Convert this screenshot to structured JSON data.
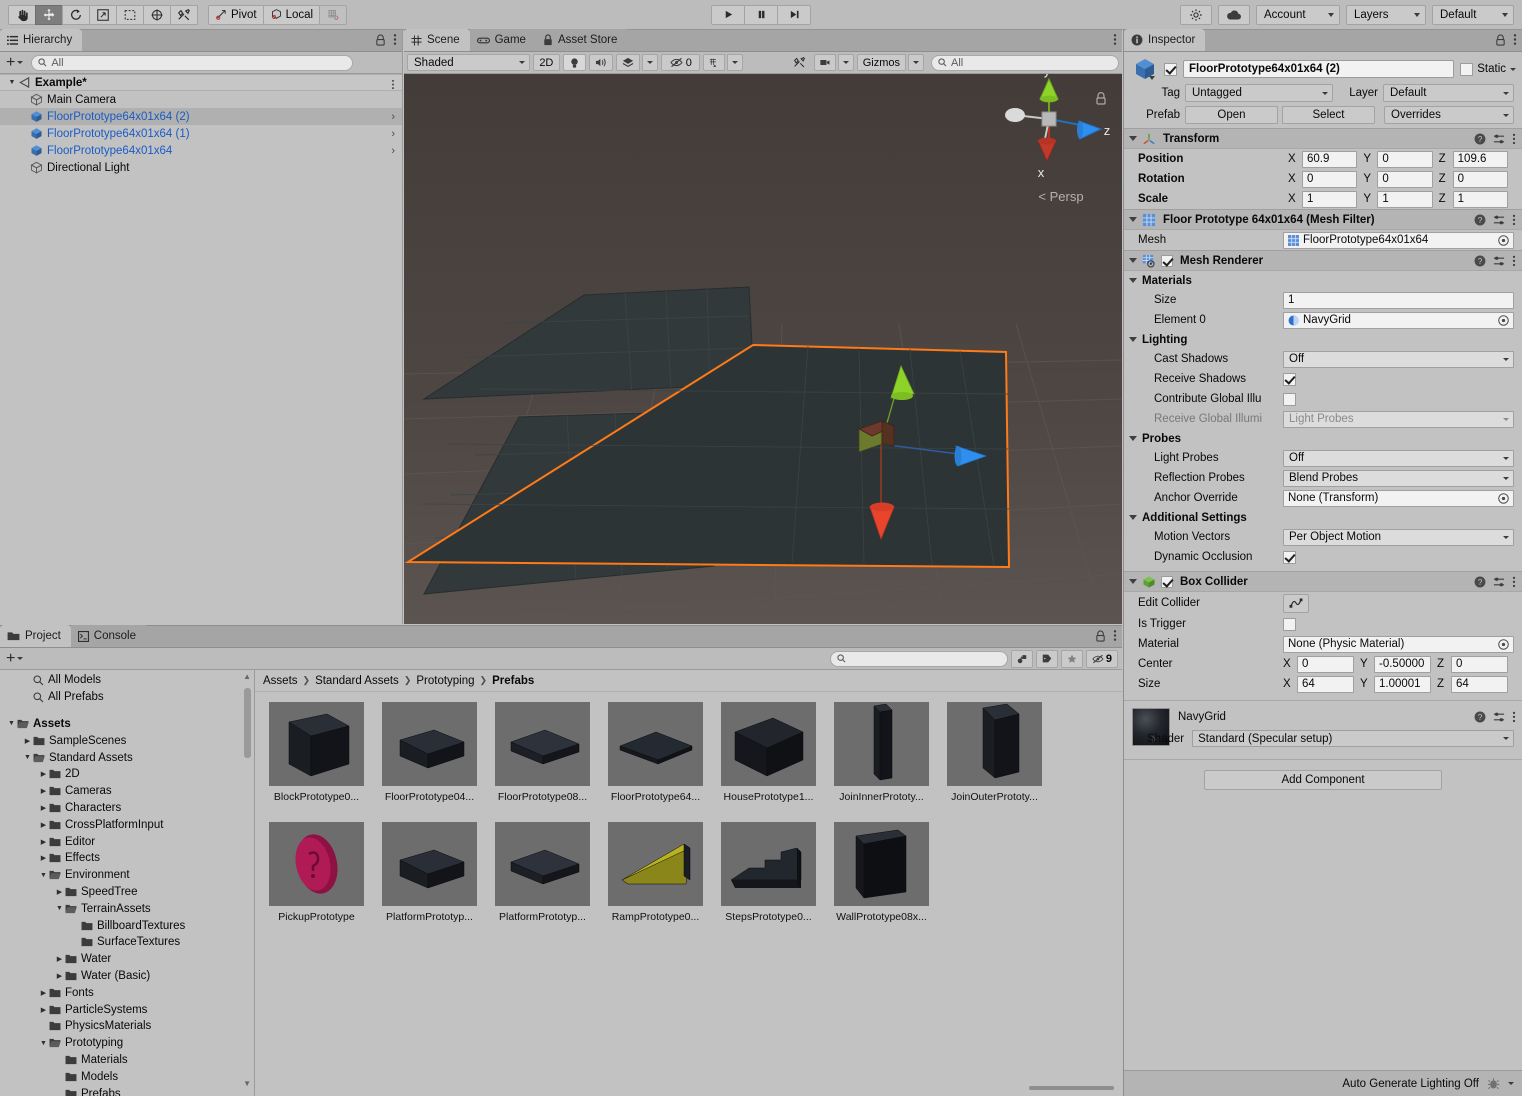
{
  "toolbar": {
    "tools": [
      {
        "name": "hand-tool",
        "icon": "✋",
        "active": false
      },
      {
        "name": "move-tool",
        "icon": "move",
        "active": true
      },
      {
        "name": "rotate-tool",
        "icon": "rotate",
        "active": false
      },
      {
        "name": "scale-tool",
        "icon": "scale",
        "active": false
      },
      {
        "name": "rect-tool",
        "icon": "rect",
        "active": false
      },
      {
        "name": "transform-tool",
        "icon": "transform",
        "active": false
      },
      {
        "name": "custom-tool",
        "icon": "wrench",
        "active": false
      }
    ],
    "pivot_label": "Pivot",
    "local_label": "Local",
    "grid_snap_label": "",
    "play_label": "▶",
    "pause_label": "❚❚",
    "step_label": "▶❚",
    "cloud_label": "",
    "account_label": "Account",
    "layers_label": "Layers",
    "layout_label": "Default"
  },
  "hierarchy": {
    "tab_label": "Hierarchy",
    "search_placeholder": "All",
    "scene_name": "Example*",
    "items": [
      {
        "label": "Main Camera",
        "type": "gameobject",
        "prefab": false,
        "selected": false,
        "chevron": false
      },
      {
        "label": "FloorPrototype64x01x64 (2)",
        "type": "prefab",
        "prefab": true,
        "selected": true,
        "chevron": true
      },
      {
        "label": "FloorPrototype64x01x64 (1)",
        "type": "prefab",
        "prefab": true,
        "selected": false,
        "chevron": true
      },
      {
        "label": "FloorPrototype64x01x64",
        "type": "prefab",
        "prefab": true,
        "selected": false,
        "chevron": true
      },
      {
        "label": "Directional Light",
        "type": "gameobject",
        "prefab": false,
        "selected": false,
        "chevron": false
      }
    ]
  },
  "scene": {
    "tabs": [
      {
        "label": "Scene",
        "icon": "grid-icon",
        "active": true
      },
      {
        "label": "Game",
        "icon": "gamepad-icon",
        "active": false
      },
      {
        "label": "Asset Store",
        "icon": "store-icon",
        "active": false
      }
    ],
    "draw_mode": "Shaded",
    "two_d_label": "2D",
    "hidden_count": "0",
    "gizmos_label": "Gizmos",
    "search_placeholder": "All",
    "axis_labels": {
      "x": "x",
      "y": "y",
      "z": "z"
    },
    "perspective_label": "Persp"
  },
  "project": {
    "tabs": [
      {
        "label": "Project",
        "icon": "folder-icon",
        "active": true
      },
      {
        "label": "Console",
        "icon": "console-icon",
        "active": false
      }
    ],
    "search_placeholder": "",
    "hidden_count": "9",
    "tree": [
      {
        "label": "All Models",
        "depth": 1,
        "arrow": "none",
        "icon": "search",
        "bold": false,
        "open": false
      },
      {
        "label": "All Prefabs",
        "depth": 1,
        "arrow": "none",
        "icon": "search",
        "bold": false,
        "open": false
      },
      {
        "label": "",
        "depth": 0,
        "arrow": "none",
        "icon": "spacer",
        "bold": false,
        "open": false
      },
      {
        "label": "Assets",
        "depth": 0,
        "arrow": "down",
        "icon": "folder-open",
        "bold": true,
        "open": true
      },
      {
        "label": "SampleScenes",
        "depth": 1,
        "arrow": "right",
        "icon": "folder",
        "bold": false,
        "open": false
      },
      {
        "label": "Standard Assets",
        "depth": 1,
        "arrow": "down",
        "icon": "folder-open",
        "bold": false,
        "open": true
      },
      {
        "label": "2D",
        "depth": 2,
        "arrow": "right",
        "icon": "folder",
        "bold": false,
        "open": false
      },
      {
        "label": "Cameras",
        "depth": 2,
        "arrow": "right",
        "icon": "folder",
        "bold": false,
        "open": false
      },
      {
        "label": "Characters",
        "depth": 2,
        "arrow": "right",
        "icon": "folder",
        "bold": false,
        "open": false
      },
      {
        "label": "CrossPlatformInput",
        "depth": 2,
        "arrow": "right",
        "icon": "folder",
        "bold": false,
        "open": false
      },
      {
        "label": "Editor",
        "depth": 2,
        "arrow": "right",
        "icon": "folder",
        "bold": false,
        "open": false
      },
      {
        "label": "Effects",
        "depth": 2,
        "arrow": "right",
        "icon": "folder",
        "bold": false,
        "open": false
      },
      {
        "label": "Environment",
        "depth": 2,
        "arrow": "down",
        "icon": "folder-open",
        "bold": false,
        "open": true
      },
      {
        "label": "SpeedTree",
        "depth": 3,
        "arrow": "right",
        "icon": "folder",
        "bold": false,
        "open": false
      },
      {
        "label": "TerrainAssets",
        "depth": 3,
        "arrow": "down",
        "icon": "folder-open",
        "bold": false,
        "open": true
      },
      {
        "label": "BillboardTextures",
        "depth": 4,
        "arrow": "none",
        "icon": "folder",
        "bold": false,
        "open": false
      },
      {
        "label": "SurfaceTextures",
        "depth": 4,
        "arrow": "none",
        "icon": "folder",
        "bold": false,
        "open": false
      },
      {
        "label": "Water",
        "depth": 3,
        "arrow": "right",
        "icon": "folder",
        "bold": false,
        "open": false
      },
      {
        "label": "Water (Basic)",
        "depth": 3,
        "arrow": "right",
        "icon": "folder",
        "bold": false,
        "open": false
      },
      {
        "label": "Fonts",
        "depth": 2,
        "arrow": "right",
        "icon": "folder",
        "bold": false,
        "open": false
      },
      {
        "label": "ParticleSystems",
        "depth": 2,
        "arrow": "right",
        "icon": "folder",
        "bold": false,
        "open": false
      },
      {
        "label": "PhysicsMaterials",
        "depth": 2,
        "arrow": "none",
        "icon": "folder",
        "bold": false,
        "open": false
      },
      {
        "label": "Prototyping",
        "depth": 2,
        "arrow": "down",
        "icon": "folder-open",
        "bold": false,
        "open": true
      },
      {
        "label": "Materials",
        "depth": 3,
        "arrow": "none",
        "icon": "folder",
        "bold": false,
        "open": false
      },
      {
        "label": "Models",
        "depth": 3,
        "arrow": "none",
        "icon": "folder",
        "bold": false,
        "open": false
      },
      {
        "label": "Prefabs",
        "depth": 3,
        "arrow": "none",
        "icon": "folder",
        "bold": false,
        "open": false
      }
    ],
    "breadcrumb": [
      "Assets",
      "Standard Assets",
      "Prototyping",
      "Prefabs"
    ],
    "assets": [
      {
        "label": "BlockPrototype0...",
        "shape": "cube",
        "color": "#1d2026"
      },
      {
        "label": "FloorPrototype04...",
        "shape": "slab",
        "color": "#22252b"
      },
      {
        "label": "FloorPrototype08...",
        "shape": "slab-thin",
        "color": "#23262c"
      },
      {
        "label": "FloorPrototype64...",
        "shape": "plane",
        "color": "#242830"
      },
      {
        "label": "HousePrototype1...",
        "shape": "box",
        "color": "#191b20"
      },
      {
        "label": "JoinInnerPrototy...",
        "shape": "column-thin",
        "color": "#15171b"
      },
      {
        "label": "JoinOuterPrototy...",
        "shape": "column",
        "color": "#1a1c22"
      },
      {
        "label": "PickupPrototype",
        "shape": "coin",
        "color": "#9e1449"
      },
      {
        "label": "PlatformPrototyp...",
        "shape": "slab",
        "color": "#22252b"
      },
      {
        "label": "PlatformPrototyp...",
        "shape": "slab-thin",
        "color": "#262a32"
      },
      {
        "label": "RampPrototype0...",
        "shape": "ramp",
        "color": "#9a9617"
      },
      {
        "label": "StepsPrototype0...",
        "shape": "steps",
        "color": "#1d2026"
      },
      {
        "label": "WallPrototype08x...",
        "shape": "wall",
        "color": "#141619"
      }
    ]
  },
  "inspector": {
    "tab_label": "Inspector",
    "object_name": "FloorPrototype64x01x64 (2)",
    "enabled": true,
    "static_label": "Static",
    "tag_label": "Tag",
    "tag_value": "Untagged",
    "layer_label": "Layer",
    "layer_value": "Default",
    "prefab_label": "Prefab",
    "prefab_open": "Open",
    "prefab_select": "Select",
    "prefab_overrides": "Overrides",
    "transform": {
      "title": "Transform",
      "rows": [
        {
          "label": "Position",
          "x": "60.9",
          "y": "0",
          "z": "109.6"
        },
        {
          "label": "Rotation",
          "x": "0",
          "y": "0",
          "z": "0"
        },
        {
          "label": "Scale",
          "x": "1",
          "y": "1",
          "z": "1"
        }
      ]
    },
    "mesh_filter": {
      "title": "Floor Prototype 64x01x64 (Mesh Filter)",
      "mesh_label": "Mesh",
      "mesh_value": "FloorPrototype64x01x64"
    },
    "mesh_renderer": {
      "title": "Mesh Renderer",
      "enabled": true,
      "materials_label": "Materials",
      "size_label": "Size",
      "size_value": "1",
      "element0_label": "Element 0",
      "element0_value": "NavyGrid",
      "lighting_label": "Lighting",
      "cast_shadows_label": "Cast Shadows",
      "cast_shadows_value": "Off",
      "receive_shadows_label": "Receive Shadows",
      "receive_shadows_checked": true,
      "contribute_gi_label": "Contribute Global Illu",
      "contribute_gi_checked": false,
      "receive_gi_label": "Receive Global Illumi",
      "receive_gi_value": "Light Probes",
      "probes_label": "Probes",
      "light_probes_label": "Light Probes",
      "light_probes_value": "Off",
      "reflection_probes_label": "Reflection Probes",
      "reflection_probes_value": "Blend Probes",
      "anchor_override_label": "Anchor Override",
      "anchor_override_value": "None (Transform)",
      "additional_settings_label": "Additional Settings",
      "motion_vectors_label": "Motion Vectors",
      "motion_vectors_value": "Per Object Motion",
      "dynamic_occlusion_label": "Dynamic Occlusion",
      "dynamic_occlusion_checked": true
    },
    "box_collider": {
      "title": "Box Collider",
      "enabled": true,
      "edit_collider_label": "Edit Collider",
      "is_trigger_label": "Is Trigger",
      "is_trigger_checked": false,
      "material_label": "Material",
      "material_value": "None (Physic Material)",
      "center_label": "Center",
      "center": {
        "x": "0",
        "y": "-0.50000",
        "z": "0"
      },
      "size_label": "Size",
      "size": {
        "x": "64",
        "y": "1.00001",
        "z": "64"
      }
    },
    "material": {
      "name": "NavyGrid",
      "shader_label": "Shader",
      "shader_value": "Standard (Specular setup)"
    },
    "add_component_label": "Add Component",
    "status_text": "Auto Generate Lighting Off"
  },
  "colors": {
    "selection_outline": "#ff7a18",
    "prefab_blue": "#1a5cc4",
    "axis_x": "#e8452c",
    "axis_y": "#8ed327",
    "axis_z": "#2f8ff0",
    "panel_bg": "#c2c2c2",
    "scene_bg": "#4a4340"
  }
}
